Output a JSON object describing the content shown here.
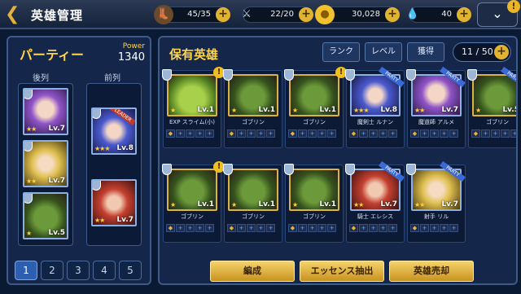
{
  "header": {
    "title": "英雄管理"
  },
  "resources": [
    {
      "icon": "boot-icon",
      "value": "45/35",
      "color": "#b08050"
    },
    {
      "icon": "swords-icon",
      "value": "22/20",
      "color": "#cfd6e6"
    },
    {
      "icon": "coin-icon",
      "value": "30,028",
      "color": "#f2c22e"
    },
    {
      "icon": "blood-drop-icon",
      "value": "40",
      "color": "#d82a2a"
    }
  ],
  "menu": {
    "badge": "!"
  },
  "party": {
    "title": "パーティー",
    "power_label": "Power",
    "power_value": "1340",
    "back_label": "後列",
    "front_label": "前列",
    "back_row": [
      {
        "level": "Lv.7",
        "stars": "★★",
        "style": "purple"
      },
      {
        "level": "Lv.7",
        "stars": "★★",
        "style": "blonde"
      },
      {
        "level": "Lv.5",
        "stars": "★",
        "style": "goblin"
      }
    ],
    "front_row": [
      {
        "level": "Lv.8",
        "stars": "★★★",
        "style": "blue",
        "leader": "LEADER"
      },
      {
        "level": "Lv.7",
        "stars": "★★",
        "style": "red"
      }
    ],
    "pages": [
      "1",
      "2",
      "3",
      "4",
      "5"
    ]
  },
  "owned": {
    "title": "保有英雄",
    "sort_buttons": [
      "ランク",
      "レベル",
      "獲得"
    ],
    "count": "11 / 50",
    "cards_row1": [
      {
        "level": "Lv.1",
        "stars": "★",
        "name": "EXP スライム(小)",
        "style": "slime",
        "party": "",
        "exclaim": "!"
      },
      {
        "level": "Lv.1",
        "stars": "★",
        "name": "ゴブリン",
        "style": "goblin",
        "party": "",
        "exclaim": ""
      },
      {
        "level": "Lv.1",
        "stars": "★",
        "name": "ゴブリン",
        "style": "goblin",
        "party": "",
        "exclaim": "!"
      },
      {
        "level": "Lv.8",
        "stars": "★★★",
        "name": "魔剣士 ルナン",
        "style": "blue",
        "party": "PARTY",
        "exclaim": ""
      },
      {
        "level": "Lv.7",
        "stars": "★★",
        "name": "魔道師 アルメ",
        "style": "purple",
        "party": "PARTY",
        "exclaim": ""
      },
      {
        "level": "Lv.5",
        "stars": "★",
        "name": "ゴブリン",
        "style": "goblin",
        "party": "PARTY",
        "exclaim": ""
      }
    ],
    "cards_row2": [
      {
        "level": "Lv.1",
        "stars": "★",
        "name": "ゴブリン",
        "style": "goblin",
        "party": "",
        "exclaim": "!"
      },
      {
        "level": "Lv.1",
        "stars": "★",
        "name": "ゴブリン",
        "style": "goblin",
        "party": "",
        "exclaim": ""
      },
      {
        "level": "Lv.1",
        "stars": "★",
        "name": "ゴブリン",
        "style": "goblin",
        "party": "",
        "exclaim": ""
      },
      {
        "level": "Lv.7",
        "stars": "★★",
        "name": "騎士 エレシス",
        "style": "red",
        "party": "PARTY",
        "exclaim": ""
      },
      {
        "level": "Lv.7",
        "stars": "★★",
        "name": "射手 リル",
        "style": "blonde",
        "party": "PARTY",
        "exclaim": ""
      }
    ],
    "actions": [
      "編成",
      "エッセンス抽出",
      "英雄売却"
    ]
  }
}
